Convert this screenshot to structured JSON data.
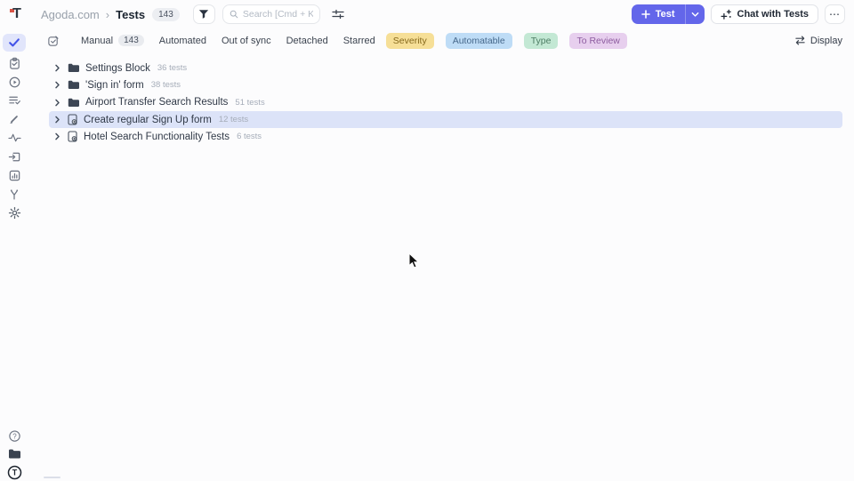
{
  "colors": {
    "accent": "#6366ea",
    "selected_row_bg": "#dce3f8",
    "sidebar_selected_bg": "#e1e5fb",
    "check_color": "#4353e8",
    "badge_severity_bg": "#f6df97",
    "badge_automatable_bg": "#bedcf6",
    "badge_type_bg": "#c3e8d4",
    "badge_to_review_bg": "#e7cfee"
  },
  "sidebar": {
    "logo_letter": "T",
    "nav_icons": [
      "tests-check-icon",
      "test-plans-clipboard-icon",
      "runs-play-icon",
      "checklist-icon",
      "pen-tool-icon",
      "pulse-icon",
      "import-inbox-icon",
      "analytics-chart-icon",
      "branch-icon",
      "settings-gear-icon"
    ],
    "footer_icons": [
      "help-circle-icon",
      "projects-folder-icon",
      "profile-avatar"
    ],
    "profile_initial": "T"
  },
  "header": {
    "breadcrumb": {
      "project": "Agoda.com",
      "separator": "›",
      "page": "Tests",
      "count": "143"
    },
    "search_placeholder": "Search [Cmd + K]",
    "test_button": {
      "label": "Test"
    },
    "chat_button": {
      "label": "Chat with Tests"
    },
    "more_label": "⋯"
  },
  "filter_bar": {
    "tabs": [
      {
        "label": "Manual",
        "count": "143"
      },
      {
        "label": "Automated"
      },
      {
        "label": "Out of sync"
      },
      {
        "label": "Detached"
      },
      {
        "label": "Starred"
      }
    ],
    "badges": [
      {
        "label": "Severity",
        "bg": "#f6df97",
        "fg": "#86691c"
      },
      {
        "label": "Automatable",
        "bg": "#bedcf6",
        "fg": "#46688b"
      },
      {
        "label": "Type",
        "bg": "#c3e8d4",
        "fg": "#4d7d64"
      },
      {
        "label": "To Review",
        "bg": "#e7cfee",
        "fg": "#8d5c9f"
      }
    ],
    "display_label": "Display"
  },
  "tree": {
    "rows": [
      {
        "label": "Settings Block",
        "count": "36 tests",
        "icon": "folder",
        "selected": false
      },
      {
        "label": "'Sign in' form",
        "count": "38 tests",
        "icon": "folder",
        "selected": false
      },
      {
        "label": "Airport Transfer Search Results",
        "count": "51 tests",
        "icon": "folder",
        "selected": false
      },
      {
        "label": "Create regular Sign Up form",
        "count": "12 tests",
        "icon": "file",
        "selected": true
      },
      {
        "label": "Hotel Search Functionality Tests",
        "count": "6 tests",
        "icon": "file",
        "selected": false
      }
    ]
  }
}
